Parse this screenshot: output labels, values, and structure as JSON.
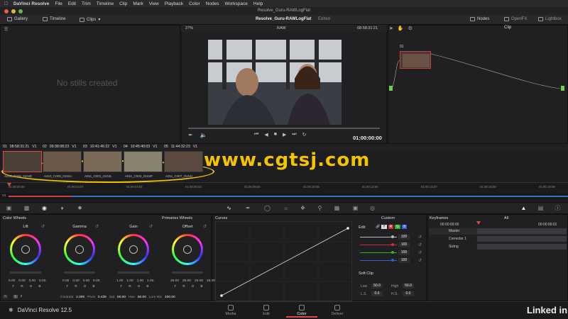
{
  "menubar": {
    "app": "DaVinci Resolve",
    "items": [
      "File",
      "Edit",
      "Trim",
      "Timeline",
      "Clip",
      "Mark",
      "View",
      "Playback",
      "Color",
      "Nodes",
      "Workspace",
      "Help"
    ]
  },
  "window_title": "Resolve_Guru-RAWLogFlat",
  "toolbar": {
    "gallery": "Gallery",
    "timeline": "Timeline",
    "clips": "Clips",
    "project": "Resolve_Guru-RAWLogFlat",
    "edited": "Edited",
    "nodes": "Nodes",
    "openfx": "OpenFX",
    "lightbox": "Lightbox"
  },
  "viewer": {
    "zoom": "27%",
    "mode": "RAW",
    "timecode": "08:58:31:21",
    "play_timecode": "01:00:00:00",
    "clip_mode": "Clip"
  },
  "gallery": {
    "empty_text": "No stills created"
  },
  "node": {
    "label": "01"
  },
  "clips": [
    {
      "num": "01",
      "tc": "08:58:31:21",
      "track": "V1",
      "name": "A010_C004_0104E"
    },
    {
      "num": "02",
      "tc": "09:38:08:23",
      "track": "V1",
      "name": "A010_C009_0104A"
    },
    {
      "num": "03",
      "tc": "10:41:46:22",
      "track": "V1",
      "name": "A011_C001_0104L"
    },
    {
      "num": "04",
      "tc": "10:45:40:03",
      "track": "V1",
      "name": "A011_C002_0104P"
    },
    {
      "num": "05",
      "tc": "11:44:32:23",
      "track": "V1",
      "name": "A011_C007_0104J"
    }
  ],
  "ruler": [
    "01:00:00:00",
    "01:00:02:07",
    "01:00:04:02",
    "01:00:06:03",
    "01:00:08:04",
    "01:00:10:05",
    "01:00:12:06",
    "01:00:14:07",
    "01:00:16:08",
    "01:00:18:09"
  ],
  "track_label": "V1",
  "watermark": "www.cgtsj.com",
  "colorwheels": {
    "title": "Color Wheels",
    "mode": "Primaries Wheels",
    "wheels": [
      {
        "label": "Lift",
        "nums": [
          "0.00",
          "0.00",
          "0.00",
          "0.00"
        ]
      },
      {
        "label": "Gamma",
        "nums": [
          "0.00",
          "0.00",
          "0.00",
          "0.00"
        ]
      },
      {
        "label": "Gain",
        "nums": [
          "1.00",
          "1.00",
          "1.00",
          "1.00"
        ]
      },
      {
        "label": "Offset",
        "nums": [
          "25.00",
          "25.00",
          "25.00",
          "25.00"
        ]
      }
    ],
    "channels": [
      "Y",
      "R",
      "G",
      "B"
    ],
    "footer": {
      "a": "A",
      "p1": "1",
      "p2": "2",
      "contrast_lbl": "Contrast",
      "contrast": "1.000",
      "pivot_lbl": "Pivot",
      "pivot": "0.435",
      "sat_lbl": "Sat",
      "sat": "50.00",
      "hue_lbl": "Hue",
      "hue": "50.00",
      "lummix_lbl": "Lum Mix",
      "lummix": "100.00"
    }
  },
  "curves": {
    "title": "Curves",
    "mode": "Custom"
  },
  "edit": {
    "title": "Edit",
    "y": "Y",
    "r": "R",
    "g": "G",
    "b": "B",
    "values": [
      "100",
      "100",
      "100",
      "100"
    ],
    "softclip": "Soft Clip",
    "low_lbl": "Low",
    "low": "50.0",
    "high_lbl": "High",
    "high": "50.0",
    "ls_lbl": "L.S.",
    "ls": "0.0",
    "hs_lbl": "H.S.",
    "hs": "0.0"
  },
  "keyframes": {
    "title": "Keyframes",
    "filter": "All",
    "tc1": "00:00:00:00",
    "tc2": "00:00:00:01",
    "rows": [
      "Master",
      "Corrector 1",
      "Sizing"
    ]
  },
  "bottom": {
    "product": "DaVinci Resolve 12.5",
    "tabs": [
      "Media",
      "Edit",
      "Color",
      "Deliver"
    ],
    "brand": "Linked in"
  },
  "colors": {
    "accent": "#e04848",
    "watermark": "#f4c300",
    "red": "#d03030",
    "green": "#30b030",
    "blue": "#3060e0"
  }
}
